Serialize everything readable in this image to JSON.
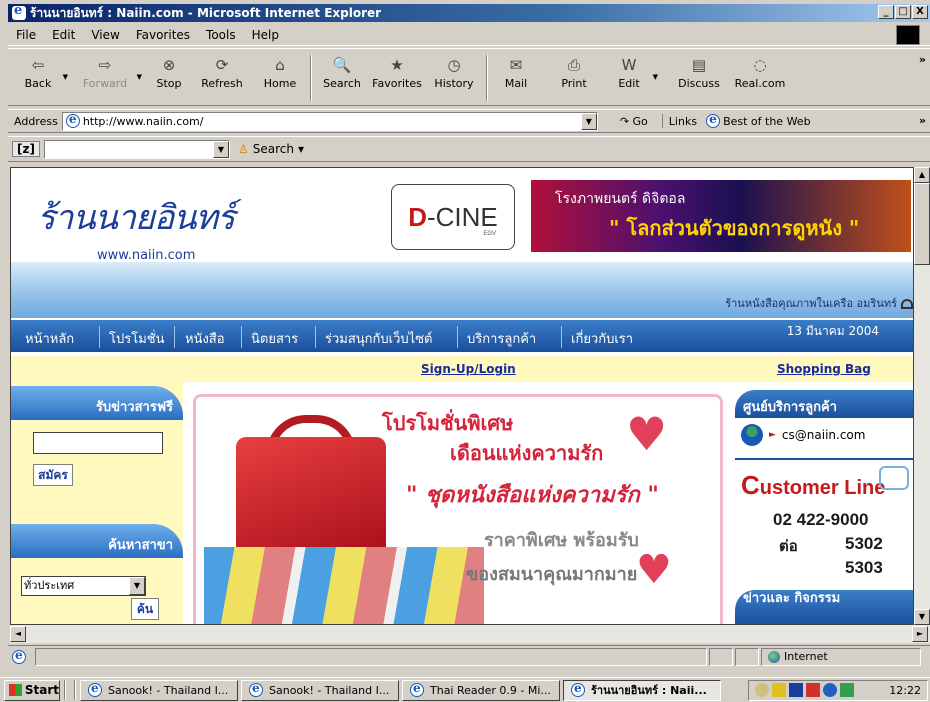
{
  "window": {
    "title": "ร้านนายอินทร์ : Naiin.com - Microsoft Internet Explorer",
    "controls": [
      "_",
      "□",
      "X"
    ]
  },
  "menu": [
    "File",
    "Edit",
    "View",
    "Favorites",
    "Tools",
    "Help"
  ],
  "toolbar": {
    "buttons": [
      {
        "label": "Back",
        "icon": "back-arrow-icon",
        "glyph": "⇦"
      },
      {
        "label": "Forward",
        "icon": "forward-arrow-icon",
        "glyph": "⇨"
      },
      {
        "label": "Stop",
        "icon": "stop-icon",
        "glyph": "⊗"
      },
      {
        "label": "Refresh",
        "icon": "refresh-icon",
        "glyph": "⟳"
      },
      {
        "label": "Home",
        "icon": "home-icon",
        "glyph": "⌂"
      },
      {
        "label": "Search",
        "icon": "search-icon",
        "glyph": "🔍"
      },
      {
        "label": "Favorites",
        "icon": "favorites-icon",
        "glyph": "★"
      },
      {
        "label": "History",
        "icon": "history-icon",
        "glyph": "◷"
      },
      {
        "label": "Mail",
        "icon": "mail-icon",
        "glyph": "✉"
      },
      {
        "label": "Print",
        "icon": "print-icon",
        "glyph": "⎙"
      },
      {
        "label": "Edit",
        "icon": "edit-icon",
        "glyph": "W"
      },
      {
        "label": "Discuss",
        "icon": "discuss-icon",
        "glyph": "▤"
      },
      {
        "label": "Real.com",
        "icon": "real-icon",
        "glyph": "◌"
      }
    ],
    "more": "»"
  },
  "address": {
    "label": "Address",
    "url": "http://www.naiin.com/",
    "go": "Go",
    "links": "Links",
    "best_of_web": "Best of the Web",
    "more": "»"
  },
  "searchbar": {
    "logo": "[z]",
    "search_label": "Search"
  },
  "site": {
    "logo_text": "ร้านนายอินทร์",
    "logo_url": "www.naiin.com",
    "dcine": {
      "d": "D",
      "rest": "-CINE",
      "egv": "EGV"
    },
    "banner": {
      "line1": "โรงภาพยนตร์ ดิจิตอล",
      "line2": "\" โลกส่วนตัวของการดูหนัง \""
    },
    "tagline": "ร้านหนังสือคุณภาพในเครือ อมรินทร์",
    "nav": [
      "หน้าหลัก",
      "โปรโมชั่น",
      "หนังสือ",
      "นิตยสาร",
      "ร่วมสนุกกับเว็บไซต์",
      "บริการลูกค้า",
      "เกี่ยวกับเรา"
    ],
    "date": "13 มีนาคม 2004",
    "signup": "Sign-Up/Login",
    "shopping_bag": "Shopping Bag",
    "left": {
      "newsletter_title": "รับข่าวสารฟรี",
      "subscribe_button": "สมัคร",
      "branch_title": "ค้นหาสาขา",
      "region_selected": "ทั่วประเทศ",
      "find_button": "ค้น"
    },
    "promo": {
      "line1": "โปรโมชั่นพิเศษ",
      "line2": "เดือนแห่งความรัก",
      "line3": "\" ชุดหนังสือแห่งความรัก \"",
      "line4": "ราคาพิเศษ พร้อมรับ",
      "line5": "ของสมนาคุณมากมาย"
    },
    "right": {
      "service_title": "ศูนย์บริการลูกค้า",
      "email": "cs@naiin.com",
      "customer_line_c": "C",
      "customer_line_rest": "ustomer Line",
      "phone": "02 422-9000",
      "ext_label": "ต่อ",
      "ext1": "5302",
      "ext2": "5303",
      "news_title": "ข่าวและ กิจกรรม"
    }
  },
  "status": {
    "zone": "Internet"
  },
  "taskbar": {
    "start": "Start",
    "tasks": [
      "Sanook! - Thailand I...",
      "Sanook! - Thailand I...",
      "Thai Reader 0.9 - Mi...",
      "ร้านนายอินทร์ : Naii..."
    ],
    "clock": "12:22"
  }
}
